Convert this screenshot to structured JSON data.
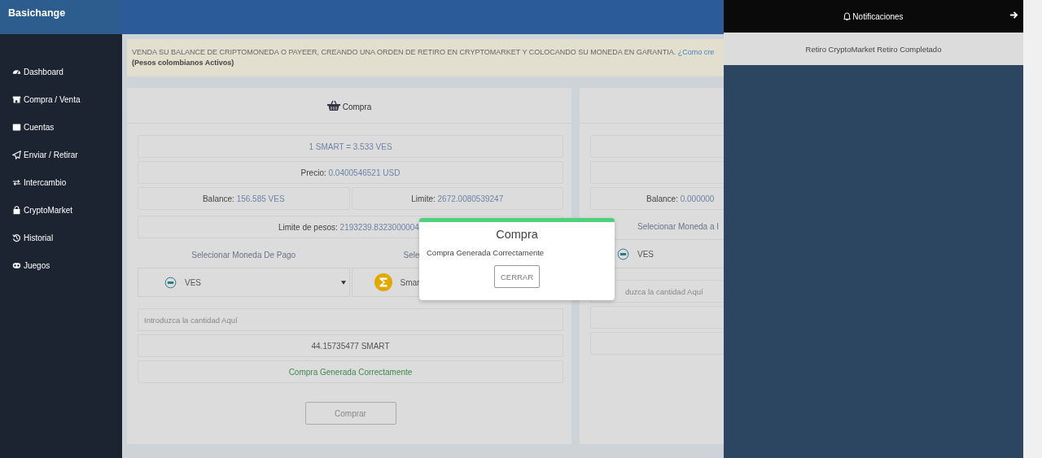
{
  "brand": "Basichange",
  "sidebar": {
    "items": [
      {
        "label": "Dashboard"
      },
      {
        "label": "Compra / Venta"
      },
      {
        "label": "Cuentas"
      },
      {
        "label": "Enviar / Retirar"
      },
      {
        "label": "Intercambio"
      },
      {
        "label": "CryptoMarket"
      },
      {
        "label": "Historial"
      },
      {
        "label": "Juegos"
      }
    ]
  },
  "notice": {
    "text": "VENDA SU BALANCE DE CRIPTOMONEDA O PAYEER, CREANDO UNA ORDEN DE RETIRO EN CRYPTOMARKET Y COLOCANDO SU MONEDA EN GARANTIA.",
    "link": "¿Como cre",
    "note": "(Pesos colombianos Activos)"
  },
  "buy_card": {
    "title": "Compra",
    "rate": "1 SMART = 3.533 VES",
    "price": {
      "label": "Precio:",
      "value": "0.0400546521 USD"
    },
    "balance": {
      "label": "Balance:",
      "value": "156.585 VES"
    },
    "limit": {
      "label": "Limite:",
      "value": "2672.0080539247"
    },
    "peso_limit": {
      "label": "Limite de pesos:",
      "value": "2193239.8323000004"
    },
    "pay_label": "Selecionar Moneda De Pago",
    "receive_label": "Sele",
    "pay_select": {
      "value": "VES"
    },
    "receive_select": {
      "value": "Smar"
    },
    "amount": {
      "placeholder": "Introduzca la cantidad Aquí"
    },
    "result": "44.15735477 SMART",
    "status": "Compra Generada Correctamente",
    "button": "Comprar"
  },
  "sell_card": {
    "balance": {
      "label": "Balance:",
      "value": "0.000000"
    },
    "select_label": "Selecionar Moneda a I",
    "select": {
      "value": "VES"
    },
    "amount": {
      "placeholder": "duzca la cantidad Aquí"
    }
  },
  "modal": {
    "title": "Compra",
    "message": "Compra Generada Correctamente",
    "button": "CERRAR"
  },
  "notifications": {
    "title": "Notificaciones",
    "items": [
      "Retiro CryptoMarket Retiro Completado"
    ]
  }
}
